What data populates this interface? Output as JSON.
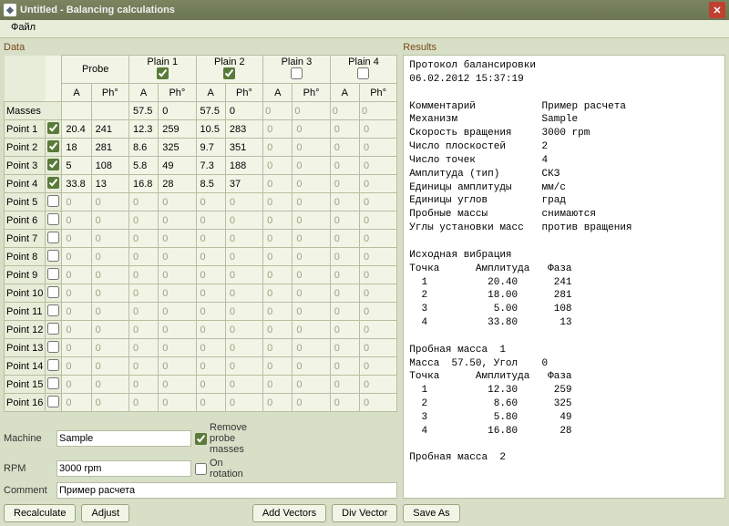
{
  "window": {
    "title": "Untitled - Balancing calculations"
  },
  "menu": {
    "file": "Файл"
  },
  "data_title": "Data",
  "results_title": "Results",
  "headers": {
    "probe": "Probe",
    "plain1": "Plain 1",
    "plain2": "Plain 2",
    "plain3": "Plain 3",
    "plain4": "Plain 4",
    "A": "A",
    "Ph": "Ph°",
    "masses": "Masses"
  },
  "plains_checked": {
    "p1": true,
    "p2": true,
    "p3": false,
    "p4": false
  },
  "masses": {
    "p1_a": "57.5",
    "p1_ph": "0",
    "p2_a": "57.5",
    "p2_ph": "0"
  },
  "point_labels": [
    "Point 1",
    "Point 2",
    "Point 3",
    "Point 4",
    "Point 5",
    "Point 6",
    "Point 7",
    "Point 8",
    "Point 9",
    "Point 10",
    "Point 11",
    "Point 12",
    "Point 13",
    "Point 14",
    "Point 15",
    "Point 16"
  ],
  "points": [
    {
      "chk": true,
      "pa": "20.4",
      "pp": "241",
      "p1a": "12.3",
      "p1p": "259",
      "p2a": "10.5",
      "p2p": "283"
    },
    {
      "chk": true,
      "pa": "18",
      "pp": "281",
      "p1a": "8.6",
      "p1p": "325",
      "p2a": "9.7",
      "p2p": "351"
    },
    {
      "chk": true,
      "pa": "5",
      "pp": "108",
      "p1a": "5.8",
      "p1p": "49",
      "p2a": "7.3",
      "p2p": "188"
    },
    {
      "chk": true,
      "pa": "33.8",
      "pp": "13",
      "p1a": "16.8",
      "p1p": "28",
      "p2a": "8.5",
      "p2p": "37"
    },
    {
      "chk": false
    },
    {
      "chk": false
    },
    {
      "chk": false
    },
    {
      "chk": false
    },
    {
      "chk": false
    },
    {
      "chk": false
    },
    {
      "chk": false
    },
    {
      "chk": false
    },
    {
      "chk": false
    },
    {
      "chk": false
    },
    {
      "chk": false
    },
    {
      "chk": false
    }
  ],
  "form": {
    "machine_lbl": "Machine",
    "machine": "Sample",
    "rpm_lbl": "RPM",
    "rpm": "3000 rpm",
    "comment_lbl": "Comment",
    "comment": "Пример расчета",
    "remove_probe": "Remove probe masses",
    "remove_probe_chk": true,
    "on_rotation": "On rotation",
    "on_rotation_chk": false
  },
  "buttons": {
    "recalc": "Recalculate",
    "adjust": "Adjust",
    "add_vec": "Add Vectors",
    "div_vec": "Div Vector",
    "save_as": "Save As"
  },
  "results_text": "Протокол балансировки\n06.02.2012 15:37:19\n\nКомментарий           Пример расчета\nМеханизм              Sample\nСкорость вращения     3000 rpm\nЧисло плоскостей      2\nЧисло точек           4\nАмплитуда (тип)       СКЗ\nЕдиницы амплитуды     мм/с\nЕдиницы углов         град\nПробные массы         снимаются\nУглы установки масс   против вращения\n\nИсходная вибрация\nТочка      Амплитуда   Фаза\n  1          20.40      241\n  2          18.00      281\n  3           5.00      108\n  4          33.80       13\n\nПробная масса  1\nМасса  57.50, Угол    0\nТочка      Амплитуда   Фаза\n  1          12.30      259\n  2           8.60      325\n  3           5.80       49\n  4          16.80       28\n\nПробная масса  2"
}
